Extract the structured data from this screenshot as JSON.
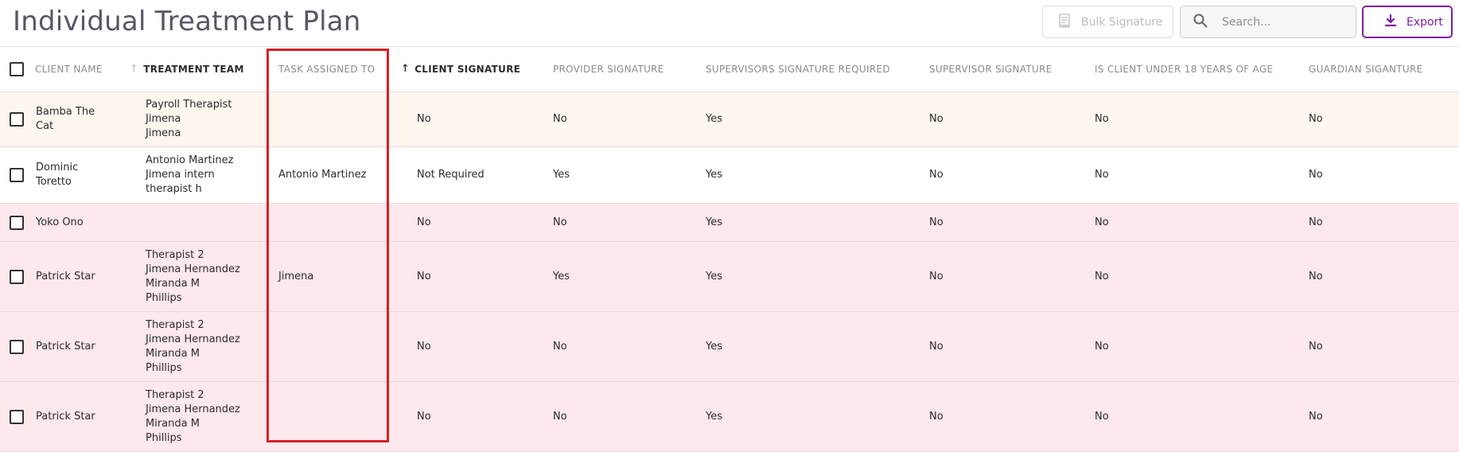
{
  "page": {
    "title": "Individual Treatment Plan"
  },
  "toolbar": {
    "bulk_signature": "Bulk Signature",
    "search_placeholder": "Search...",
    "export": "Export"
  },
  "table": {
    "columns": [
      {
        "label": "CLIENT NAME"
      },
      {
        "label": "TREATMENT TEAM"
      },
      {
        "label": "TASK ASSIGNED TO"
      },
      {
        "label": "CLIENT SIGNATURE"
      },
      {
        "label": "PROVIDER SIGNATURE"
      },
      {
        "label": "SUPERVISORS SIGNATURE REQUIRED"
      },
      {
        "label": "SUPERVISOR SIGNATURE"
      },
      {
        "label": "IS CLIENT UNDER 18 YEARS OF AGE"
      },
      {
        "label": "GUARDIAN SIGANTURE"
      }
    ],
    "rows": [
      {
        "client": [
          "Bamba The",
          "Cat"
        ],
        "team": [
          "Payroll Therapist",
          "Jimena",
          "Jimena"
        ],
        "task": "",
        "client_sig": "No",
        "provider_sig": "No",
        "sup_req": "Yes",
        "sup_sig": "No",
        "under18": "No",
        "guardian": "No"
      },
      {
        "client": [
          "Dominic",
          "Toretto"
        ],
        "team": [
          "Antonio Martinez",
          "Jimena intern",
          "therapist h"
        ],
        "task": "Antonio Martinez",
        "client_sig": "Not Required",
        "provider_sig": "Yes",
        "sup_req": "Yes",
        "sup_sig": "No",
        "under18": "No",
        "guardian": "No"
      },
      {
        "client": [
          "Yoko Ono"
        ],
        "team": [],
        "task": "",
        "client_sig": "No",
        "provider_sig": "No",
        "sup_req": "Yes",
        "sup_sig": "No",
        "under18": "No",
        "guardian": "No"
      },
      {
        "client": [
          "Patrick Star"
        ],
        "team": [
          "Therapist 2",
          "Jimena Hernandez",
          "Miranda M",
          "Phillips"
        ],
        "task": "Jimena",
        "client_sig": "No",
        "provider_sig": "Yes",
        "sup_req": "Yes",
        "sup_sig": "No",
        "under18": "No",
        "guardian": "No"
      },
      {
        "client": [
          "Patrick Star"
        ],
        "team": [
          "Therapist 2",
          "Jimena Hernandez",
          "Miranda M",
          "Phillips"
        ],
        "task": "",
        "client_sig": "No",
        "provider_sig": "No",
        "sup_req": "Yes",
        "sup_sig": "No",
        "under18": "No",
        "guardian": "No"
      },
      {
        "client": [
          "Patrick Star"
        ],
        "team": [
          "Therapist 2",
          "Jimena Hernandez",
          "Miranda M",
          "Phillips"
        ],
        "task": "",
        "client_sig": "No",
        "provider_sig": "No",
        "sup_req": "Yes",
        "sup_sig": "No",
        "under18": "No",
        "guardian": "No"
      }
    ]
  },
  "colors": {
    "accent": "#7b1fa2",
    "row_peach": "#fff6ef",
    "row_white": "#ffffff",
    "row_pink": "#fde8ec",
    "highlight": "#d81f26"
  },
  "icons": {
    "bulk": "signature-document-icon",
    "search": "search-icon",
    "export": "download-icon"
  }
}
